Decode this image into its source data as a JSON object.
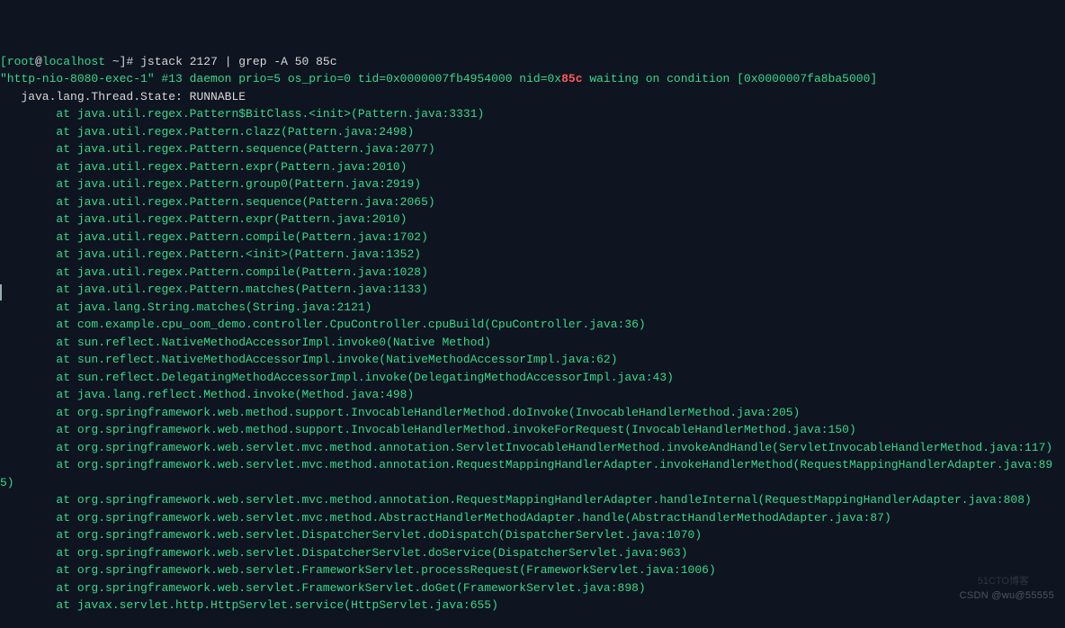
{
  "prompt": {
    "user": "[root",
    "host": "localhost",
    "path": "~",
    "suffix": "]#"
  },
  "command": "jstack 2127 | grep -A 50 85c",
  "thread": {
    "header_pre": "\"http-nio-8080-exec-1\" #13 daemon prio=5 os_prio=0 tid=0x0000007fb4954000 nid=0x",
    "nid": "85c",
    "header_post": " waiting on condition [0x0000007fa8ba5000]",
    "state_label": "java.lang.Thread.State:",
    "state_value": "RUNNABLE"
  },
  "stack": [
    "java.util.regex.Pattern$BitClass.<init>(Pattern.java:3331)",
    "java.util.regex.Pattern.clazz(Pattern.java:2498)",
    "java.util.regex.Pattern.sequence(Pattern.java:2077)",
    "java.util.regex.Pattern.expr(Pattern.java:2010)",
    "java.util.regex.Pattern.group0(Pattern.java:2919)",
    "java.util.regex.Pattern.sequence(Pattern.java:2065)",
    "java.util.regex.Pattern.expr(Pattern.java:2010)",
    "java.util.regex.Pattern.compile(Pattern.java:1702)",
    "java.util.regex.Pattern.<init>(Pattern.java:1352)",
    "java.util.regex.Pattern.compile(Pattern.java:1028)",
    "java.util.regex.Pattern.matches(Pattern.java:1133)",
    "java.lang.String.matches(String.java:2121)",
    "com.example.cpu_oom_demo.controller.CpuController.cpuBuild(CpuController.java:36)",
    "sun.reflect.NativeMethodAccessorImpl.invoke0(Native Method)",
    "sun.reflect.NativeMethodAccessorImpl.invoke(NativeMethodAccessorImpl.java:62)",
    "sun.reflect.DelegatingMethodAccessorImpl.invoke(DelegatingMethodAccessorImpl.java:43)",
    "java.lang.reflect.Method.invoke(Method.java:498)",
    "org.springframework.web.method.support.InvocableHandlerMethod.doInvoke(InvocableHandlerMethod.java:205)",
    "org.springframework.web.method.support.InvocableHandlerMethod.invokeForRequest(InvocableHandlerMethod.java:150)",
    "org.springframework.web.servlet.mvc.method.annotation.ServletInvocableHandlerMethod.invokeAndHandle(ServletInvocableHandlerMethod.java:117)",
    "org.springframework.web.servlet.mvc.method.annotation.RequestMappingHandlerAdapter.invokeHandlerMethod(RequestMappingHandlerAdapter.java:895)",
    "org.springframework.web.servlet.mvc.method.annotation.RequestMappingHandlerAdapter.handleInternal(RequestMappingHandlerAdapter.java:808)",
    "org.springframework.web.servlet.mvc.method.AbstractHandlerMethodAdapter.handle(AbstractHandlerMethodAdapter.java:87)",
    "org.springframework.web.servlet.DispatcherServlet.doDispatch(DispatcherServlet.java:1070)",
    "org.springframework.web.servlet.DispatcherServlet.doService(DispatcherServlet.java:963)",
    "org.springframework.web.servlet.FrameworkServlet.processRequest(FrameworkServlet.java:1006)",
    "org.springframework.web.servlet.FrameworkServlet.doGet(FrameworkServlet.java:898)",
    "javax.servlet.http.HttpServlet.service(HttpServlet.java:655)"
  ],
  "watermarks": {
    "primary": "CSDN @wu@55555",
    "secondary": "51CTO博客"
  }
}
